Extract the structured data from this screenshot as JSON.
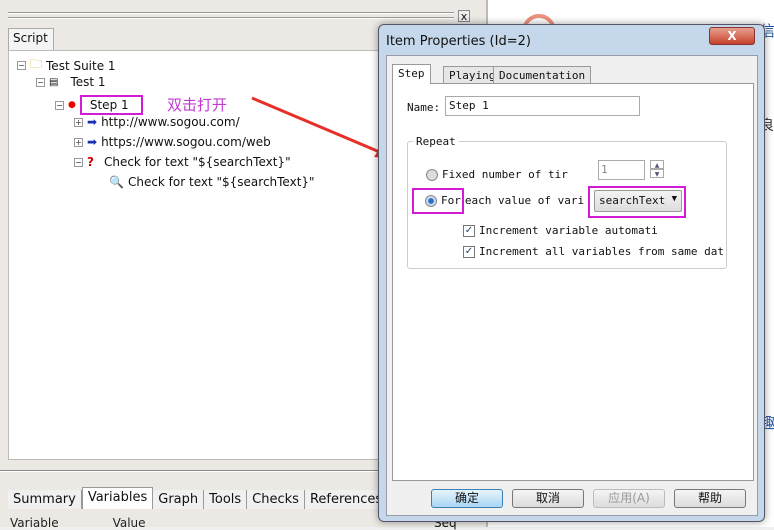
{
  "script_pane": {
    "tab": "Script",
    "close": "x",
    "tree": [
      {
        "label": "Test Suite 1",
        "icon": "folder-icon"
      },
      {
        "label": "Test 1",
        "icon": "document-icon"
      },
      {
        "label": "Step 1",
        "icon": "red-dot-icon"
      },
      {
        "label": "http://www.sogou.com/",
        "icon": "arrow-right-icon"
      },
      {
        "label": "https://www.sogou.com/web",
        "icon": "arrow-right-icon"
      },
      {
        "label": "Check for text \"${searchText}\"",
        "icon": "question-icon"
      },
      {
        "label": "Check for text \"${searchText}\"",
        "icon": "check-text-icon"
      }
    ]
  },
  "annotation": "双击打开",
  "annotation_color": "#d21bd6",
  "bottom_tabs": [
    "Summary",
    "Variables",
    "Graph",
    "Tools",
    "Checks",
    "References"
  ],
  "active_bottom_tab": "Variables",
  "columns": [
    "Variable",
    "Value",
    "Seq"
  ],
  "dialog": {
    "title": "Item Properties (Id=2)",
    "close": "X",
    "tabs": [
      "Step",
      "Playing",
      "Documentation"
    ],
    "name_label": "Name:",
    "name_value": "Step 1",
    "repeat_label": "Repeat",
    "fixed_label": "Fixed number of tir",
    "fixed_value": "1",
    "foreach_label_a": "For",
    "foreach_label_b": "each value of vari",
    "variable_select": "searchText",
    "cb1": "Increment variable automati",
    "cb2": "Increment all variables from same dat",
    "buttons": {
      "ok": "确定",
      "cancel": "取消",
      "apply": "应用(A)",
      "help": "帮助"
    }
  },
  "background_chars": [
    "信",
    "良",
    "趣"
  ]
}
